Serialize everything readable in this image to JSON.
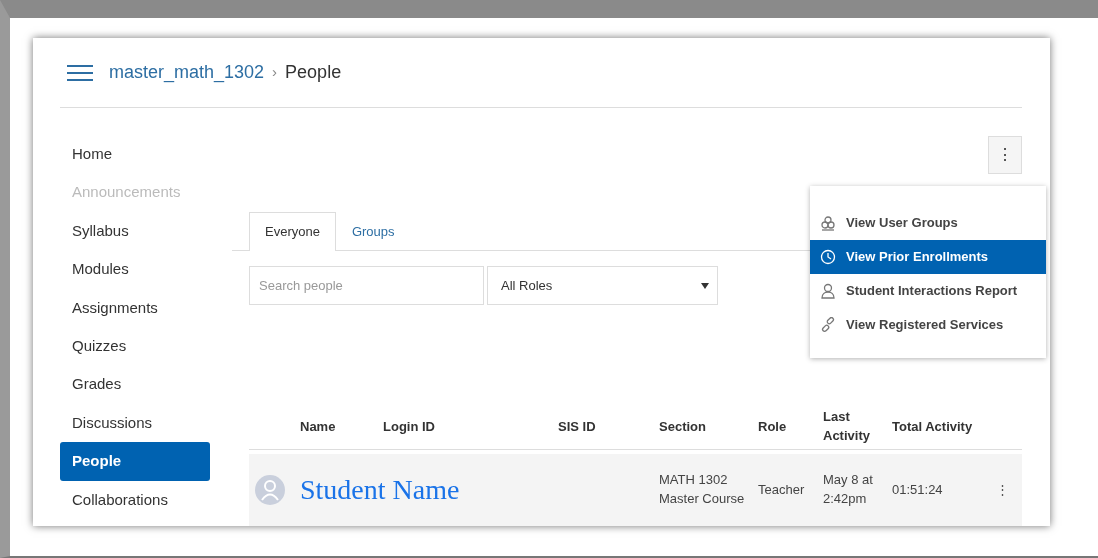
{
  "breadcrumb": {
    "course": "master_math_1302",
    "separator": "›",
    "page": "People"
  },
  "sidebar": {
    "items": [
      {
        "label": "Home",
        "selected": false,
        "disabled": false
      },
      {
        "label": "Announcements",
        "selected": false,
        "disabled": true
      },
      {
        "label": "Syllabus",
        "selected": false,
        "disabled": false
      },
      {
        "label": "Modules",
        "selected": false,
        "disabled": false
      },
      {
        "label": "Assignments",
        "selected": false,
        "disabled": false
      },
      {
        "label": "Quizzes",
        "selected": false,
        "disabled": false
      },
      {
        "label": "Grades",
        "selected": false,
        "disabled": false
      },
      {
        "label": "Discussions",
        "selected": false,
        "disabled": false
      },
      {
        "label": "People",
        "selected": true,
        "disabled": false
      },
      {
        "label": "Collaborations",
        "selected": false,
        "disabled": false
      }
    ]
  },
  "options_button": {
    "label": "⋮"
  },
  "menu": {
    "items": [
      {
        "label": "View User Groups",
        "kind": "groups",
        "selected": false
      },
      {
        "label": "View Prior Enrollments",
        "kind": "clock",
        "selected": true
      },
      {
        "label": "Student Interactions Report",
        "kind": "person",
        "selected": false
      },
      {
        "label": "View Registered Services",
        "kind": "link",
        "selected": false
      }
    ]
  },
  "tabs": [
    {
      "label": "Everyone",
      "selected": true
    },
    {
      "label": "Groups",
      "selected": false
    }
  ],
  "search": {
    "placeholder": "Search people"
  },
  "role_filter": {
    "value": "All Roles"
  },
  "table": {
    "columns": [
      "Name",
      "Login ID",
      "SIS ID",
      "Section",
      "Role",
      "Last Activity",
      "Total Activity"
    ],
    "rows": [
      {
        "name": "Student Name",
        "section": "MATH 1302 Master Course",
        "role": "Teacher",
        "last_activity": "May 8 at 2:42pm",
        "total_activity": "01:51:24",
        "actions": "⋮"
      }
    ]
  }
}
